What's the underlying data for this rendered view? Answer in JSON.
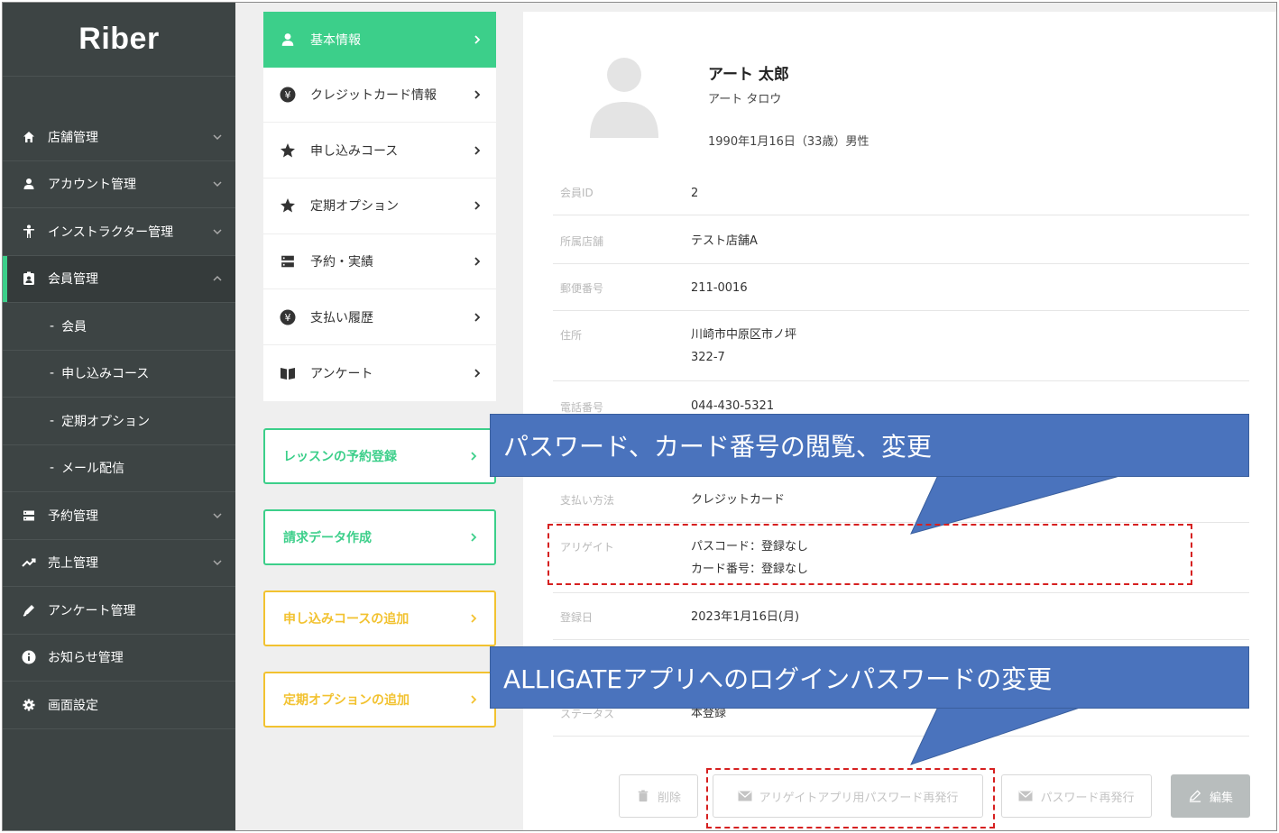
{
  "app": {
    "logo": "Riber"
  },
  "sidebar": {
    "items": [
      {
        "label": "店舗管理",
        "icon": "home-icon"
      },
      {
        "label": "アカウント管理",
        "icon": "user-icon"
      },
      {
        "label": "インストラクター管理",
        "icon": "person-icon"
      },
      {
        "label": "会員管理",
        "icon": "member-card-icon"
      },
      {
        "label": "会員"
      },
      {
        "label": "申し込みコース"
      },
      {
        "label": "定期オプション"
      },
      {
        "label": "メール配信"
      },
      {
        "label": "予約管理",
        "icon": "server-icon"
      },
      {
        "label": "売上管理",
        "icon": "trend-icon"
      },
      {
        "label": "アンケート管理",
        "icon": "pen-icon"
      },
      {
        "label": "お知らせ管理",
        "icon": "info-icon"
      },
      {
        "label": "画面設定",
        "icon": "gear-icon"
      }
    ],
    "sub_prefix": "-"
  },
  "menu": {
    "items": [
      {
        "label": "基本情報"
      },
      {
        "label": "クレジットカード情報"
      },
      {
        "label": "申し込みコース"
      },
      {
        "label": "定期オプション"
      },
      {
        "label": "予約・実績"
      },
      {
        "label": "支払い履歴"
      },
      {
        "label": "アンケート"
      }
    ],
    "actions": [
      {
        "label": "レッスンの予約登録"
      },
      {
        "label": "請求データ作成"
      },
      {
        "label": "申し込みコースの追加"
      },
      {
        "label": "定期オプションの追加"
      }
    ]
  },
  "profile": {
    "name": "アート 太郎",
    "kana": "アート タロウ",
    "dob": "1990年1月16日（33歳）男性",
    "fields": [
      {
        "label": "会員ID",
        "value": "2"
      },
      {
        "label": "所属店舗",
        "value": "テスト店舗A"
      },
      {
        "label": "郵便番号",
        "value": "211-0016"
      },
      {
        "label": "住所",
        "value": "川崎市中原区市ノ坪",
        "value2": "322-7"
      },
      {
        "label": "電話番号",
        "value": "044-430-5321"
      },
      {
        "label": "支払い方法",
        "value": "クレジットカード"
      },
      {
        "label": "アリゲイト",
        "value": "パスコード：登録なし",
        "value2": "カード番号：登録なし"
      },
      {
        "label": "登録日",
        "value": "2023年1月16日(月)"
      },
      {
        "label": "ステータス",
        "value": "本登録"
      }
    ],
    "buttons": {
      "delete": "削除",
      "alligate_reissue": "アリゲイトアプリ用パスワード再発行",
      "password_reissue": "パスワード再発行",
      "edit": "編集"
    }
  },
  "callouts": {
    "top": "パスワード、カード番号の閲覧、変更",
    "bottom": "ALLIGATEアプリへのログインパスワードの変更"
  },
  "colors": {
    "accent_green": "#3ccf8a",
    "accent_yellow": "#f2c230",
    "sidebar_bg": "#3d4444",
    "callout_blue": "#4a73bd",
    "dashed_red": "#d62020"
  }
}
